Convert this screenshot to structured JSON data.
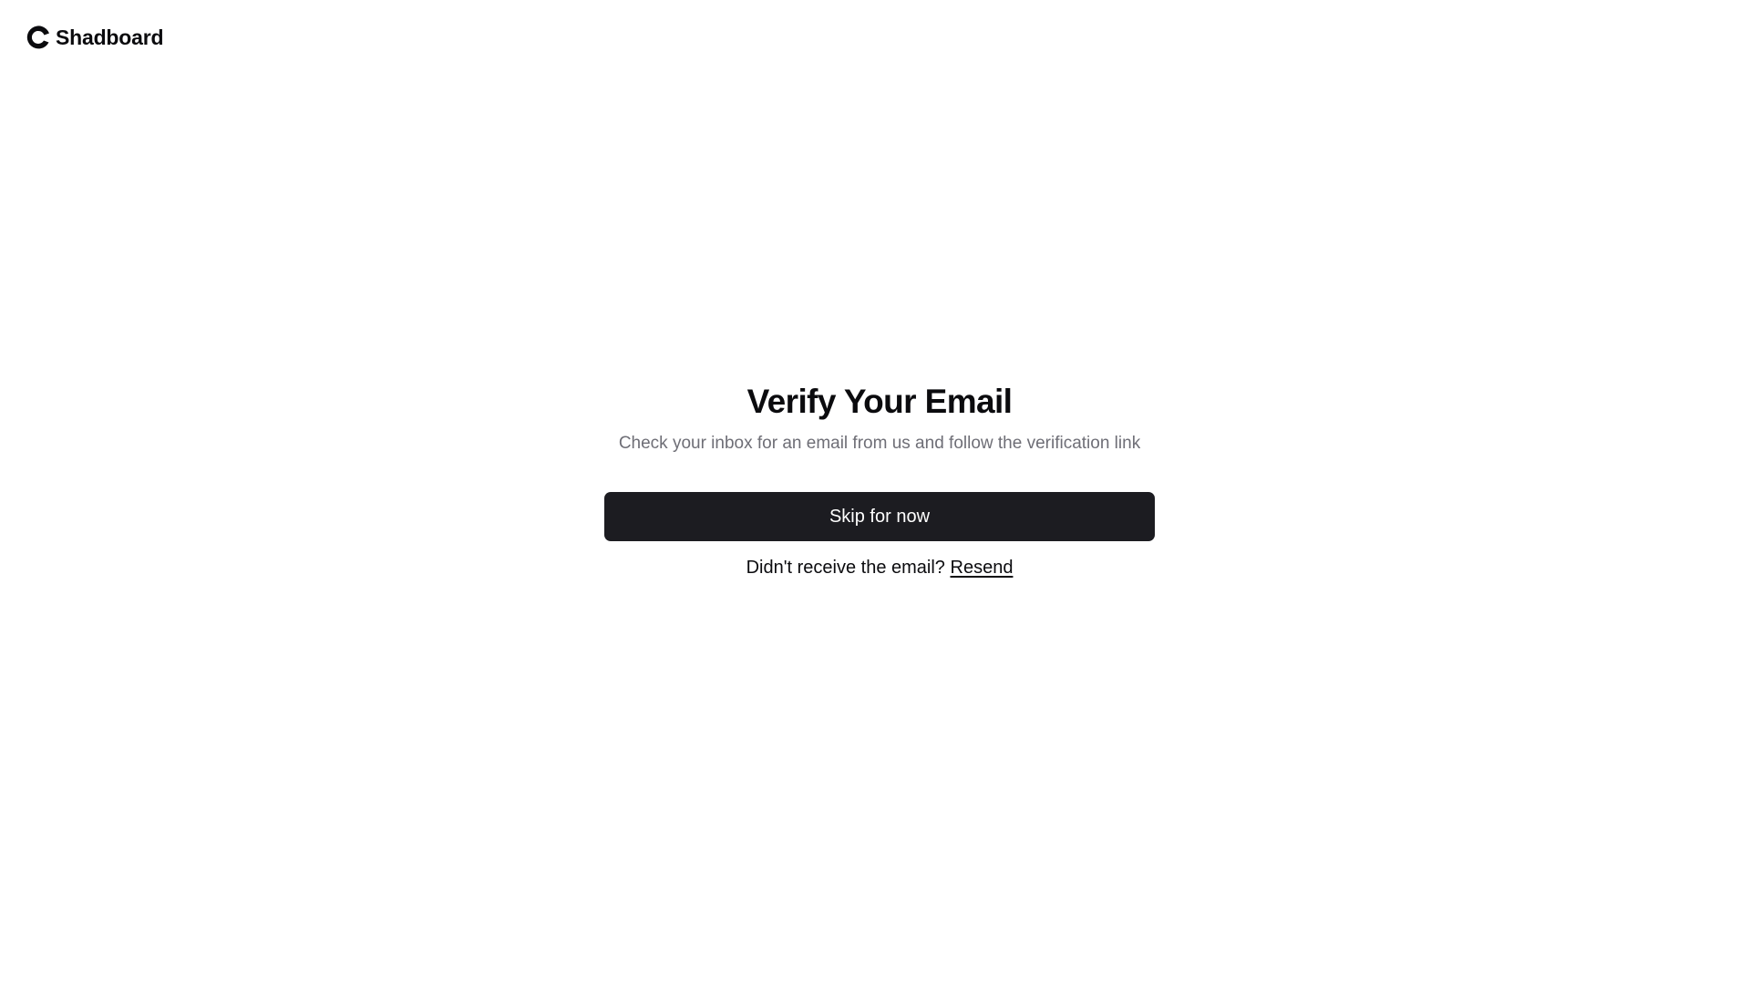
{
  "brand": {
    "name": "Shadboard",
    "icon": "crescent-logo-icon"
  },
  "verify": {
    "title": "Verify Your Email",
    "subtitle": "Check your inbox for an email from us and follow the verification link",
    "skip_label": "Skip for now",
    "resend_prompt": "Didn't receive the email?",
    "resend_label": "Resend"
  },
  "colors": {
    "button_bg": "#1c1c21",
    "subtitle_text": "#6e6e76",
    "page_bg": "#ffffff"
  }
}
